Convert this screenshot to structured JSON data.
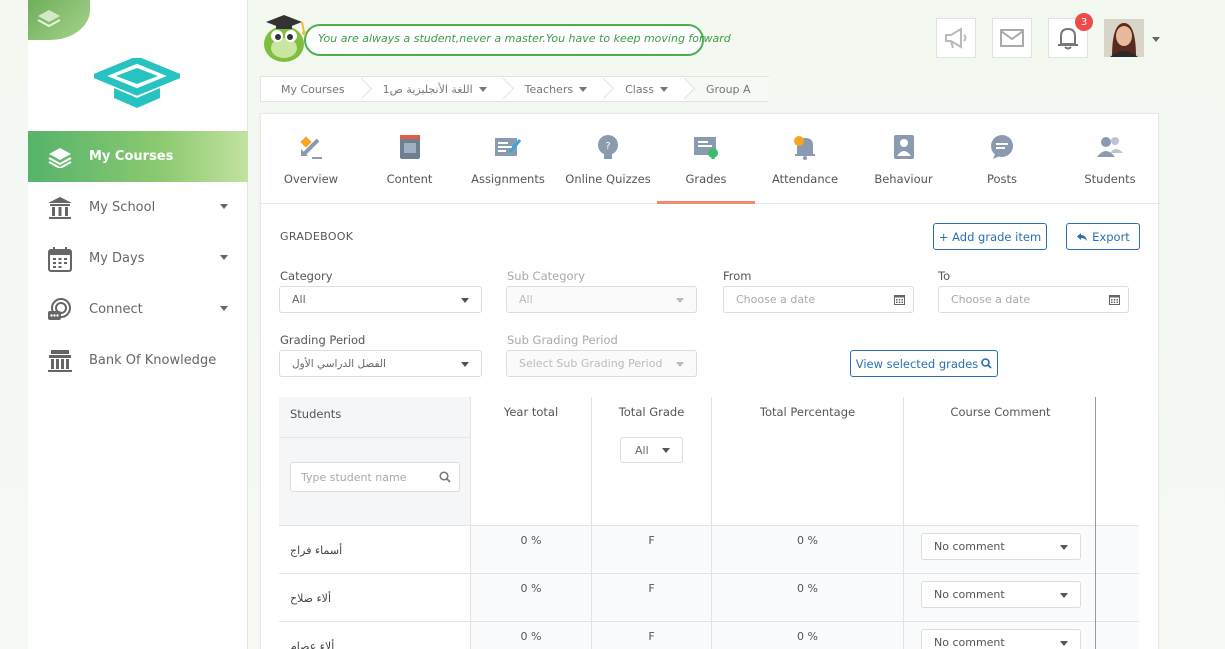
{
  "sidebar": {
    "items": [
      {
        "label": "My Courses",
        "icon": "books-icon",
        "active": true,
        "has_dropdown": false
      },
      {
        "label": "My School",
        "icon": "school-icon",
        "active": false,
        "has_dropdown": true
      },
      {
        "label": "My Days",
        "icon": "calendar-icon",
        "active": false,
        "has_dropdown": true
      },
      {
        "label": "Connect",
        "icon": "chat-icon",
        "active": false,
        "has_dropdown": true
      },
      {
        "label": "Bank Of Knowledge",
        "icon": "bank-icon",
        "active": false,
        "has_dropdown": false
      }
    ]
  },
  "header": {
    "quote": "You are always a student,never a master.You have to keep moving forward",
    "notification_count": "3"
  },
  "breadcrumb": {
    "items": [
      {
        "label": "My Courses",
        "dropdown": false
      },
      {
        "label": "اللغة الأنجليزية ص1",
        "dropdown": true
      },
      {
        "label": "Teachers",
        "dropdown": true
      },
      {
        "label": "Class",
        "dropdown": true
      },
      {
        "label": "Group A",
        "dropdown": false
      }
    ]
  },
  "tabs": [
    {
      "label": "Overview",
      "icon": "overview-icon"
    },
    {
      "label": "Content",
      "icon": "content-icon"
    },
    {
      "label": "Assignments",
      "icon": "assignments-icon"
    },
    {
      "label": "Online Quizzes",
      "icon": "quiz-icon"
    },
    {
      "label": "Grades",
      "icon": "grades-icon",
      "active": true
    },
    {
      "label": "Attendance",
      "icon": "attendance-icon"
    },
    {
      "label": "Behaviour",
      "icon": "behaviour-icon"
    },
    {
      "label": "Posts",
      "icon": "posts-icon"
    },
    {
      "label": "Students",
      "icon": "students-icon"
    }
  ],
  "gradebook": {
    "title": "GRADEBOOK",
    "add_button": "+ Add grade item",
    "export_button": "Export",
    "filters": {
      "category_label": "Category",
      "category_value": "All",
      "subcategory_label": "Sub Category",
      "subcategory_value": "All",
      "from_label": "From",
      "from_placeholder": "Choose a date",
      "to_label": "To",
      "to_placeholder": "Choose a date",
      "grading_period_label": "Grading Period",
      "grading_period_value": "الفصل الدراسي الأول",
      "sub_grading_period_label": "Sub Grading Period",
      "sub_grading_period_placeholder": "Select Sub Grading Period",
      "view_button": "View selected grades"
    },
    "table": {
      "headers": {
        "students": "Students",
        "year_total": "Year total",
        "total_grade": "Total Grade",
        "total_grade_filter": "All",
        "total_percentage": "Total Percentage",
        "course_comment": "Course Comment"
      },
      "search_placeholder": "Type student name",
      "rows": [
        {
          "name": "أسماء فراج",
          "year_total": "0 %",
          "total_grade": "F",
          "total_percentage": "0 %",
          "comment": "No comment"
        },
        {
          "name": "ألاء صلاح",
          "year_total": "0 %",
          "total_grade": "F",
          "total_percentage": "0 %",
          "comment": "No comment"
        },
        {
          "name": "ألاء عصام",
          "year_total": "0 %",
          "total_grade": "F",
          "total_percentage": "0 %",
          "comment": "No comment"
        }
      ]
    }
  },
  "colors": {
    "accent_green": "#55b36b",
    "link_blue": "#2a6fb5",
    "active_tab": "#f08a6a",
    "badge_red": "#f04b4b"
  }
}
